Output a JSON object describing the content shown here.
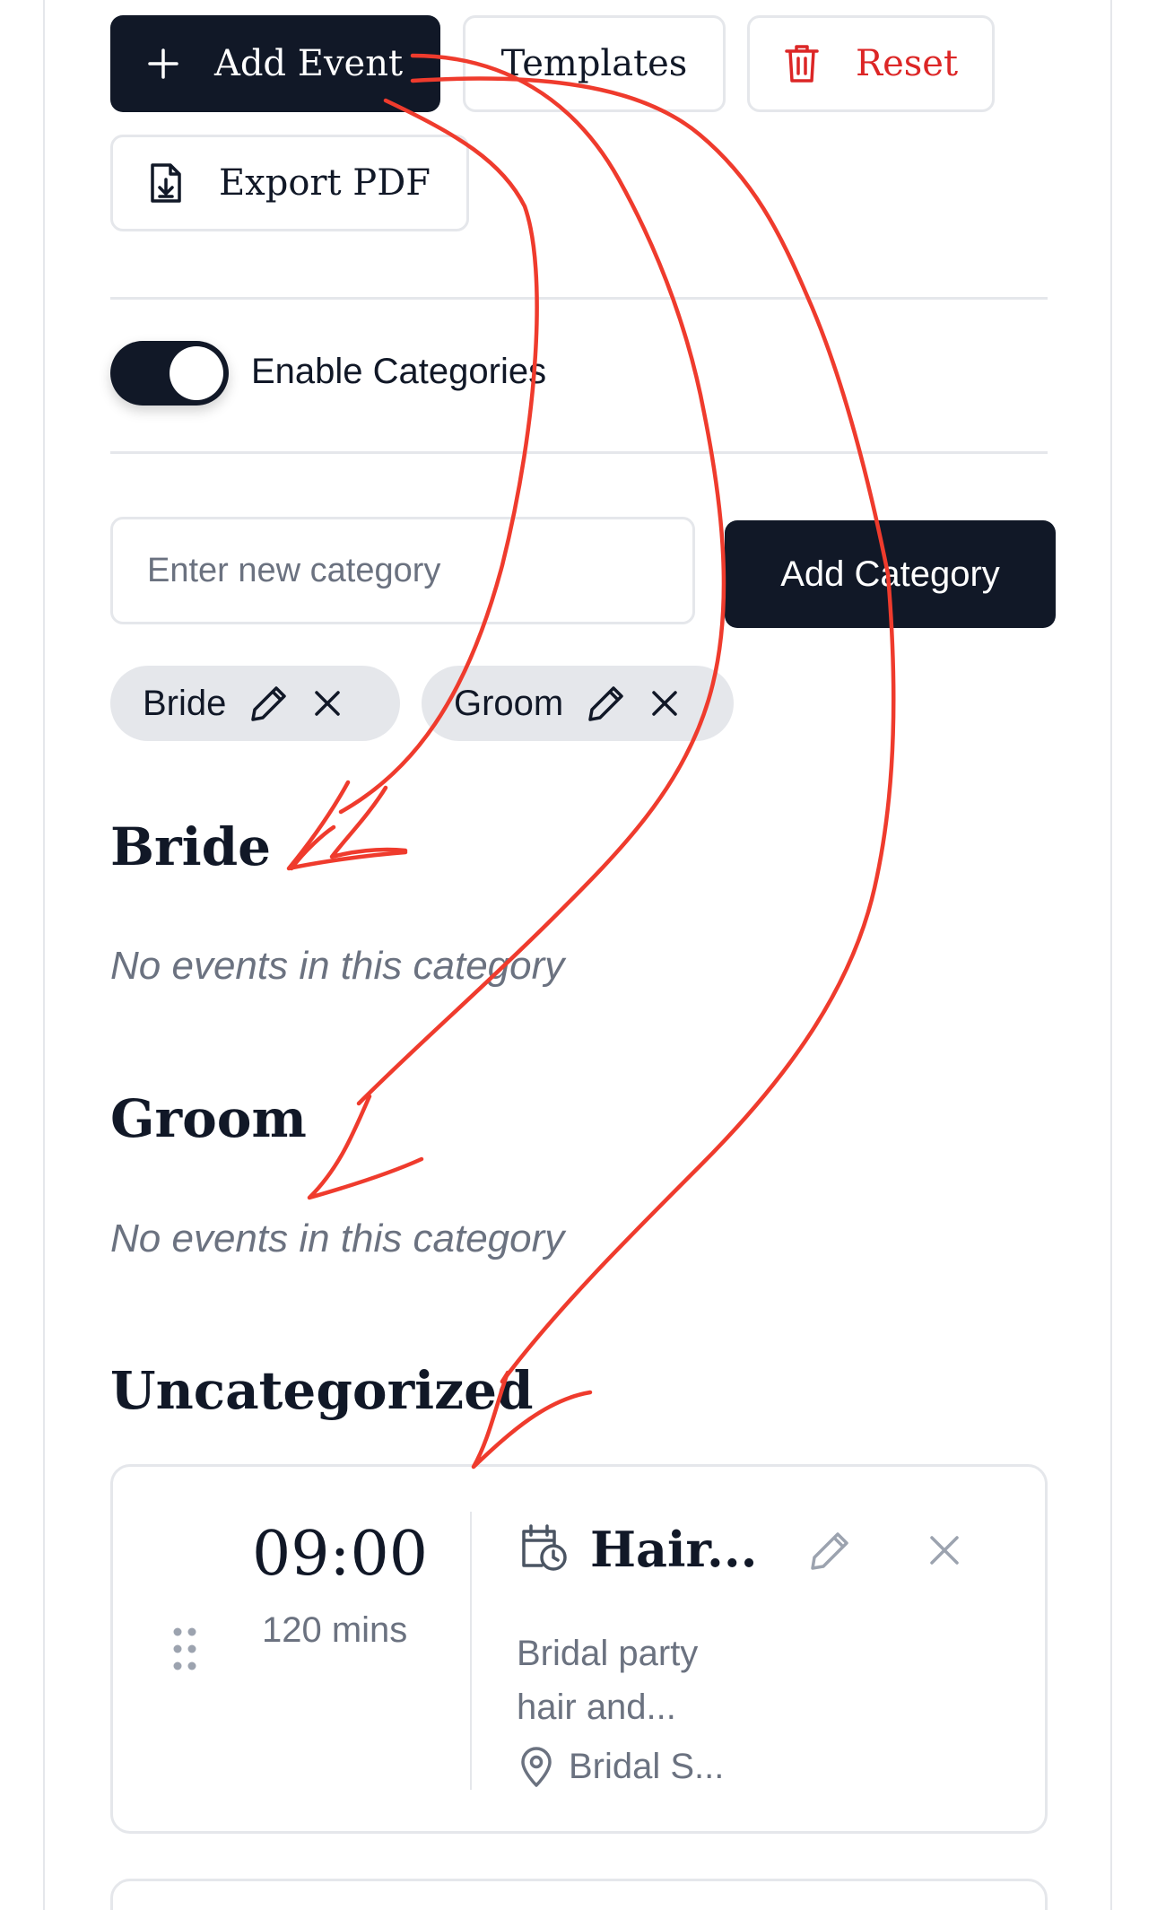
{
  "toolbar": {
    "add_event_label": "Add Event",
    "templates_label": "Templates",
    "reset_label": "Reset",
    "export_pdf_label": "Export PDF"
  },
  "categories_toggle": {
    "label": "Enable Categories",
    "enabled": true
  },
  "category_form": {
    "input_placeholder": "Enter new category",
    "input_value": "",
    "add_button_label": "Add Category"
  },
  "category_chips": [
    {
      "label": "Bride"
    },
    {
      "label": "Groom"
    }
  ],
  "sections": [
    {
      "title": "Bride",
      "empty_text": "No events in this category"
    },
    {
      "title": "Groom",
      "empty_text": "No events in this category"
    },
    {
      "title": "Uncategorized"
    }
  ],
  "events": [
    {
      "time": "09:00",
      "duration": "120 mins",
      "title": "Hair...",
      "description": "Bridal party hair and...",
      "location": "Bridal S..."
    }
  ],
  "colors": {
    "primary": "#111827",
    "danger": "#dc2626",
    "muted": "#6b7280",
    "border": "#e5e7eb",
    "chip_bg": "#e5e7eb",
    "annotation": "#ef3b2d"
  },
  "icons": {
    "add_event": "plus-icon",
    "reset": "trash-icon",
    "export_pdf": "file-download-icon",
    "chip_edit": "pencil-icon",
    "chip_remove": "close-icon",
    "event_drag": "drag-handle-icon",
    "event_type": "calendar-clock-icon",
    "event_location": "map-pin-icon",
    "event_edit": "pencil-icon",
    "event_delete": "close-icon"
  }
}
